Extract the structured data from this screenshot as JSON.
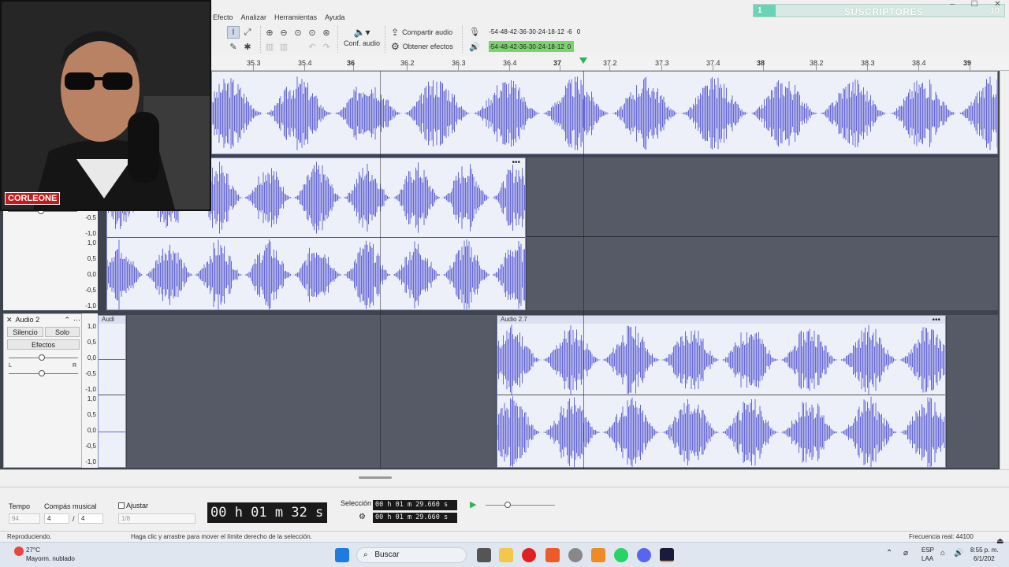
{
  "menu": {
    "items": [
      "Efecto",
      "Analizar",
      "Herramientas",
      "Ayuda"
    ]
  },
  "subscribers": {
    "left_count": "1",
    "label": "SUSCRIPTORES",
    "right_count": "10"
  },
  "toolbar": {
    "share_audio": "Compartir audio",
    "get_effects": "Obtener efectos",
    "audio_setup": "Conf. audio",
    "meter_rec_scale": [
      "-54",
      "-48",
      "-42",
      "-36",
      "-30",
      "-24",
      "-18",
      "-12",
      "-6",
      "0"
    ],
    "meter_play_scale": [
      "-54",
      "-48",
      "-42",
      "-36",
      "-30",
      "-24",
      "-18",
      "-12",
      "0"
    ]
  },
  "ruler": {
    "ticks": [
      "35.3",
      "35.4",
      "36",
      "36.2",
      "36.3",
      "36.4",
      "37",
      "37.2",
      "37.3",
      "37.4",
      "38",
      "38.2",
      "38.3",
      "38.4",
      "39"
    ],
    "bold_ticks": [
      "36",
      "37",
      "38",
      "39"
    ]
  },
  "tracks": {
    "scale_labels": [
      "1,0",
      "0,5",
      "0,0",
      "-0,5",
      "-1,0"
    ],
    "track2": {
      "name": "Audio 2",
      "mute": "Silencio",
      "solo": "Solo",
      "effects": "Efectos",
      "pan_left": "L",
      "pan_right": "R",
      "clip_a_title": "Audi",
      "clip_b_title": "Audio 2.7"
    }
  },
  "bottom": {
    "tempo_label": "Tempo",
    "tempo_value": "94",
    "time_sig_label": "Compás musical",
    "time_sig_num": "4",
    "time_sig_sep": "/",
    "time_sig_den": "4",
    "snap_label": "Ajustar",
    "snap_value": "1/8",
    "time_display": "00 h 01 m 32 s",
    "selection_label": "Selección",
    "selection_start": "00 h 01 m 29.660 s",
    "selection_end": "00 h 01 m 29.660 s"
  },
  "status": {
    "state": "Reproduciendo.",
    "hint": "Haga clic y arrastre para mover el límite derecho de la selección.",
    "rate": "Frecuencia real: 44100"
  },
  "taskbar": {
    "weather_temp": "27°C",
    "weather_desc": "Mayorm. nublado",
    "search": "Buscar",
    "lang": "ESP",
    "lang2": "LAA",
    "time": "8:55 p. m.",
    "date": "6/1/202"
  },
  "webcam_overlay": "CORLEONE",
  "colors": {
    "waveform": "#6668d6",
    "clip_bg": "#eef0f9",
    "track_bg": "#3e434d",
    "accent": "#67d3b7"
  }
}
